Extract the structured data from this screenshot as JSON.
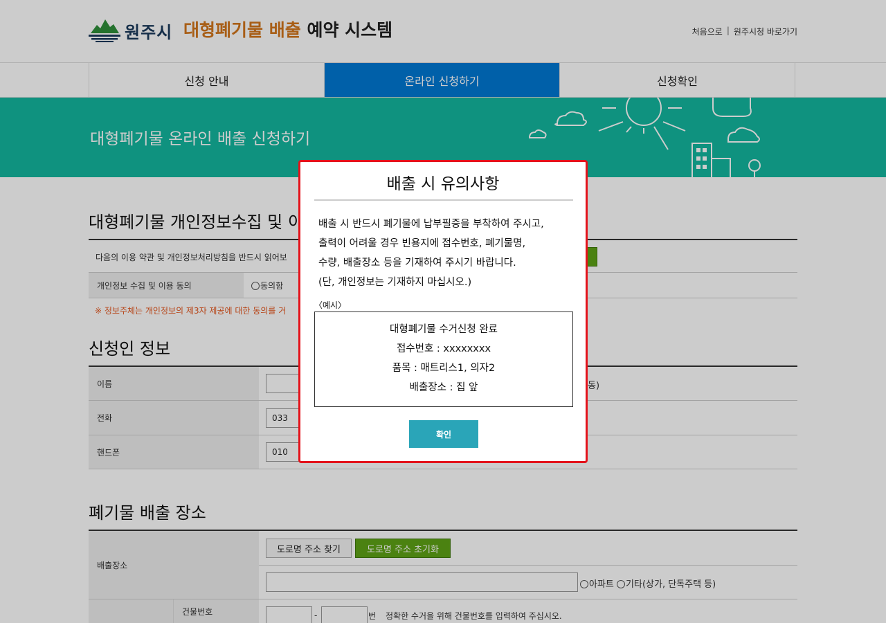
{
  "header": {
    "logo_text": "원주시",
    "title_highlight": "대형폐기물 배출",
    "title_rest": "예약 시스템",
    "util_links": [
      "처음으로",
      "원주시청 바로가기"
    ],
    "util_sep": "|"
  },
  "nav": {
    "items": [
      "신청 안내",
      "온라인 신청하기",
      "신청확인"
    ],
    "active_index": 1
  },
  "banner": {
    "title": "대형폐기물 온라인 배출 신청하기"
  },
  "privacy": {
    "title": "대형폐기물 개인정보수집 및 이",
    "notice": "다음의 이용 약관 및 개인정보처리방침을 반드시 읽어보",
    "row_label": "개인정보 수집 및 이용 동의",
    "agree_label": "동의함",
    "warning": "※ 정보주체는 개인정보의 제3자 제공에 대한 동의를 거"
  },
  "applicant": {
    "title": "신청인 정보",
    "name_label": "이름",
    "name_suffix": "동)",
    "phone_label": "전화",
    "phone_prefix": "033",
    "mobile_label": "핸드폰",
    "mobile_prefix": "010"
  },
  "location": {
    "title": "폐기물 배출 장소",
    "row_label": "배출장소",
    "find_button": "도로명 주소 찾기",
    "reset_button": "도로명 주소 초기화",
    "option_apartment": "아파트",
    "option_other": "기타(상가, 단독주택 등)",
    "building_label": "건물번호",
    "building_dash": "-",
    "building_unit": "번",
    "building_hint": "정확한 수거을 위해 건물번호를 입력하여 주십시오."
  },
  "modal": {
    "title": "배출 시 유의사항",
    "body_lines": [
      "배출 시 반드시 폐기물에 납부필증을 부착하여 주시고,",
      "출력이 어려울 경우 빈용지에 접수번호, 폐기물명,",
      "수량, 배출장소 등을 기재하여 주시기 바랍니다.",
      "(단, 개인정보는 기재하지 마십시오.)"
    ],
    "example_label": "〈예시〉",
    "example_lines": [
      "대형폐기물 수거신청 완료",
      "접수번호 : xxxxxxxx",
      "품목 : 매트리스1, 의자2",
      "배출장소 : 집 앞"
    ],
    "confirm_button": "확인"
  },
  "colors": {
    "accent_orange": "#d2761c",
    "nav_active": "#0079d4",
    "banner_green": "#13b79f",
    "modal_border": "#e3131b",
    "confirm_button": "#2aa5b8",
    "green_button": "#5ea316"
  }
}
